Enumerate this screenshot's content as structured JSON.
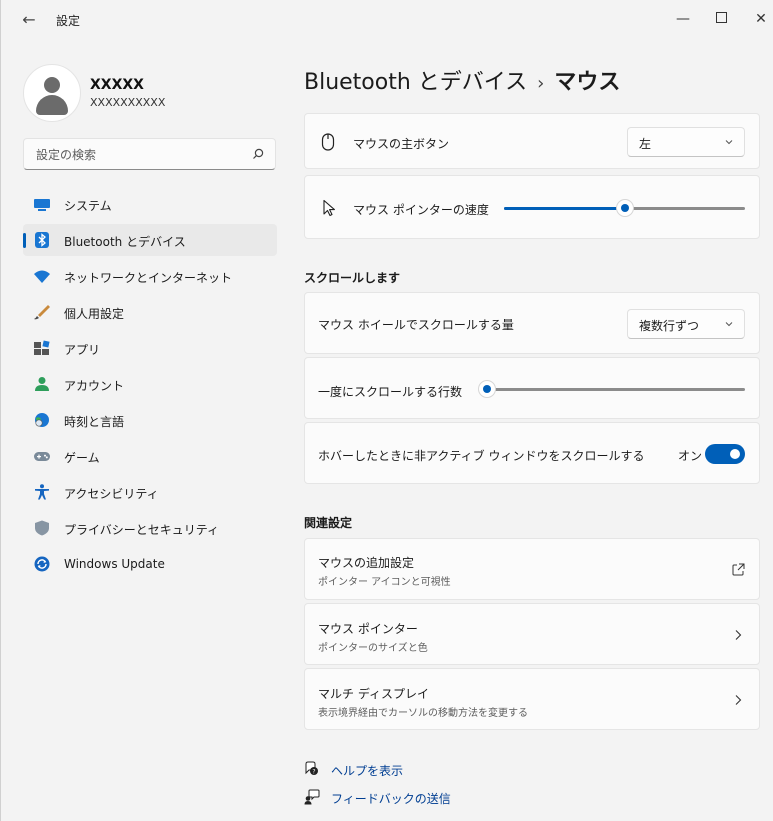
{
  "window": {
    "title": "設定",
    "back_glyph": "←",
    "min_glyph": "—",
    "close_glyph": "✕"
  },
  "profile": {
    "name": "XXXXX",
    "email": "XXXXXXXXXX"
  },
  "search": {
    "placeholder": "設定の検索"
  },
  "sidebar": {
    "items": [
      {
        "label": "システム",
        "icon": "system-icon",
        "active": false
      },
      {
        "label": "Bluetooth とデバイス",
        "icon": "bluetooth-icon",
        "active": true
      },
      {
        "label": "ネットワークとインターネット",
        "icon": "network-icon",
        "active": false
      },
      {
        "label": "個人用設定",
        "icon": "personalization-icon",
        "active": false
      },
      {
        "label": "アプリ",
        "icon": "apps-icon",
        "active": false
      },
      {
        "label": "アカウント",
        "icon": "accounts-icon",
        "active": false
      },
      {
        "label": "時刻と言語",
        "icon": "time-language-icon",
        "active": false
      },
      {
        "label": "ゲーム",
        "icon": "gaming-icon",
        "active": false
      },
      {
        "label": "アクセシビリティ",
        "icon": "accessibility-icon",
        "active": false
      },
      {
        "label": "プライバシーとセキュリティ",
        "icon": "privacy-icon",
        "active": false
      },
      {
        "label": "Windows Update",
        "icon": "windows-update-icon",
        "active": false
      }
    ]
  },
  "breadcrumb": {
    "parent": "Bluetooth とデバイス",
    "separator": "›",
    "current": "マウス"
  },
  "settings": {
    "primary_button": {
      "label": "マウスの主ボタン",
      "value": "左"
    },
    "pointer_speed": {
      "label": "マウス ポインターの速度",
      "value_fraction": 0.5
    },
    "scroll_section_title": "スクロールします",
    "wheel_scroll_amount": {
      "label": "マウス ホイールでスクロールする量",
      "value": "複数行ずつ"
    },
    "lines_per_scroll": {
      "label": "一度にスクロールする行数",
      "value_fraction": 0.03
    },
    "inactive_scroll": {
      "label": "ホバーしたときに非アクティブ ウィンドウをスクロールする",
      "state_label": "オン",
      "on": true
    }
  },
  "related": {
    "title": "関連設定",
    "items": [
      {
        "title": "マウスの追加設定",
        "subtitle": "ポインター アイコンと可視性",
        "action": "external-link-icon"
      },
      {
        "title": "マウス ポインター",
        "subtitle": "ポインターのサイズと色",
        "action": "chevron-right-icon"
      },
      {
        "title": "マルチ ディスプレイ",
        "subtitle": "表示境界経由でカーソルの移動方法を変更する",
        "action": "chevron-right-icon"
      }
    ]
  },
  "footer_links": {
    "help": "ヘルプを表示",
    "feedback": "フィードバックの送信"
  },
  "colors": {
    "accent": "#005fb8",
    "background": "#f3f3f3",
    "card": "#fbfbfb"
  }
}
